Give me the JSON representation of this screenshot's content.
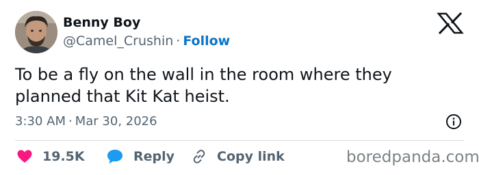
{
  "author": {
    "name": "Benny Boy",
    "handle": "@Camel_Crushin",
    "separator": "·",
    "follow_label": "Follow"
  },
  "tweet": {
    "text": "To be a fly on the wall in the room where they planned that Kit Kat heist."
  },
  "meta": {
    "time": "3:30 AM",
    "separator": "·",
    "date": "Mar 30, 2026"
  },
  "actions": {
    "like_count": "19.5K",
    "reply_label": "Reply",
    "copy_label": "Copy link"
  },
  "watermark": "boredpanda.com",
  "icons": {
    "logo": "x-logo-icon",
    "info": "info-icon",
    "like": "heart-icon",
    "reply": "speech-bubble-icon",
    "copy": "link-icon"
  },
  "colors": {
    "link_blue": "#0a74c7",
    "heart_pink": "#f91880",
    "reply_blue": "#1d9bf0",
    "secondary_text": "#536471"
  }
}
